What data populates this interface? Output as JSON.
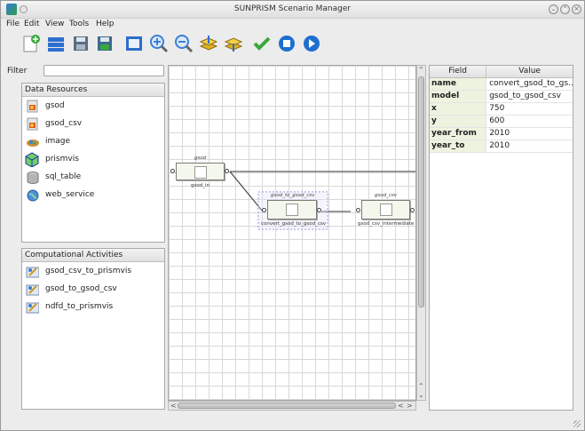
{
  "window": {
    "title": "SUNPRISM Scenario Manager"
  },
  "menu": [
    "File",
    "Edit",
    "View",
    "Tools",
    "Help"
  ],
  "toolbar": [
    {
      "icon": "new-icon",
      "color": "#2c8ee0"
    },
    {
      "icon": "open-icon",
      "color": "#2c6fd0"
    },
    {
      "icon": "save-icon",
      "color": "#5a6e82"
    },
    {
      "icon": "save-as-icon",
      "color": "#3c6a8f"
    },
    {
      "icon": "fit-view-icon",
      "color": "#2a6ec8"
    },
    {
      "icon": "zoom-in-icon",
      "color": "#3a80d6"
    },
    {
      "icon": "zoom-out-icon",
      "color": "#3a80d6"
    },
    {
      "icon": "layers-up-icon",
      "color": "#e0b020"
    },
    {
      "icon": "layers-down-icon",
      "color": "#e0b020"
    },
    {
      "icon": "validate-icon",
      "color": "#3aa83a"
    },
    {
      "icon": "stop-icon",
      "color": "#1e6fd0"
    },
    {
      "icon": "run-icon",
      "color": "#1e6fd0"
    }
  ],
  "filter": {
    "label": "Filter",
    "value": ""
  },
  "data_resources": {
    "header": "Data Resources",
    "items": [
      {
        "label": "gsod",
        "icon": "dataset-icon"
      },
      {
        "label": "gsod_csv",
        "icon": "dataset-icon"
      },
      {
        "label": "image",
        "icon": "image-icon"
      },
      {
        "label": "prismvis",
        "icon": "cube-icon"
      },
      {
        "label": "sql_table",
        "icon": "database-icon"
      },
      {
        "label": "web_service",
        "icon": "globe-icon"
      }
    ]
  },
  "activities": {
    "header": "Computational Activities",
    "items": [
      {
        "label": "gsod_csv_to_prismvis",
        "icon": "activity-icon"
      },
      {
        "label": "gsod_to_gsod_csv",
        "icon": "activity-icon"
      },
      {
        "label": "ndfd_to_prismvis",
        "icon": "activity-icon"
      }
    ]
  },
  "canvas": {
    "nodes": [
      {
        "title": "gsod",
        "label": "gsod_in"
      },
      {
        "title": "gsod_to_gsod_csv",
        "label": "convert_gsod_to_gsod_csv"
      },
      {
        "title": "gsod_csv",
        "label": "gsod_csv_intermediate"
      }
    ]
  },
  "properties": {
    "headers": [
      "Field",
      "Value"
    ],
    "rows": [
      {
        "field": "name",
        "value": "convert_gsod_to_gs..."
      },
      {
        "field": "model",
        "value": "gsod_to_gsod_csv"
      },
      {
        "field": "x",
        "value": "750"
      },
      {
        "field": "y",
        "value": "600"
      },
      {
        "field": "year_from",
        "value": "2010"
      },
      {
        "field": "year_to",
        "value": "2010"
      }
    ]
  }
}
